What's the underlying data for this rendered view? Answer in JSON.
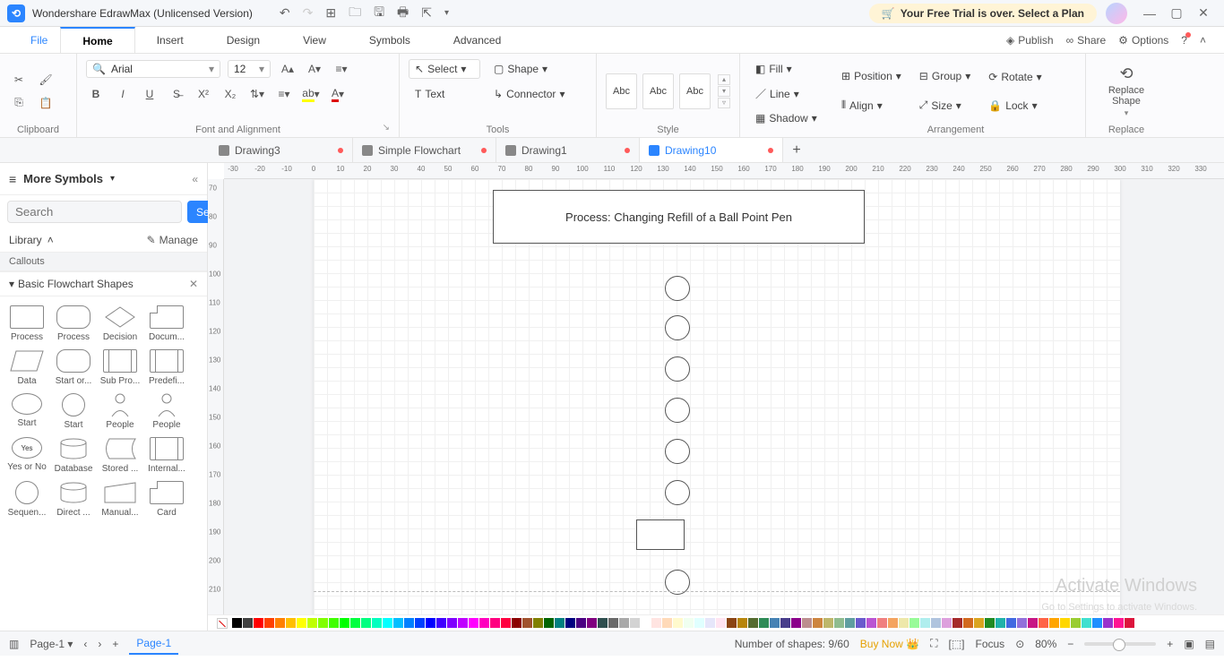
{
  "titlebar": {
    "app_title": "Wondershare EdrawMax (Unlicensed Version)",
    "trial_text": "Your Free Trial is over. Select a Plan"
  },
  "menubar": {
    "file": "File",
    "tabs": [
      "Home",
      "Insert",
      "Design",
      "View",
      "Symbols",
      "Advanced"
    ],
    "right": {
      "publish": "Publish",
      "share": "Share",
      "options": "Options"
    }
  },
  "ribbon": {
    "clipboard_label": "Clipboard",
    "font_label": "Font and Alignment",
    "tools_label": "Tools",
    "style_label": "Style",
    "arrangement_label": "Arrangement",
    "replace_label": "Replace",
    "font_name": "Arial",
    "font_size": "12",
    "select": "Select",
    "shape": "Shape",
    "text": "Text",
    "connector": "Connector",
    "style_sample": "Abc",
    "fill": "Fill",
    "line": "Line",
    "shadow": "Shadow",
    "position": "Position",
    "align": "Align",
    "group": "Group",
    "size": "Size",
    "rotate": "Rotate",
    "lock": "Lock",
    "replace_shape": "Replace\nShape"
  },
  "doctabs": {
    "tabs": [
      {
        "label": "Drawing3",
        "dirty": true
      },
      {
        "label": "Simple Flowchart",
        "dirty": true
      },
      {
        "label": "Drawing1",
        "dirty": true
      },
      {
        "label": "Drawing10",
        "dirty": true,
        "active": true
      }
    ]
  },
  "sidebar": {
    "title": "More Symbols",
    "search_placeholder": "Search",
    "search_btn": "Search",
    "library": "Library",
    "manage": "Manage",
    "callouts": "Callouts",
    "category": "Basic Flowchart Shapes",
    "shapes": [
      [
        "Process",
        "Process",
        "Decision",
        "Docum..."
      ],
      [
        "Data",
        "Start or...",
        "Sub Pro...",
        "Predefi..."
      ],
      [
        "Start",
        "Start",
        "People",
        "People"
      ],
      [
        "Yes or No",
        "Database",
        "Stored ...",
        "Internal..."
      ],
      [
        "Sequen...",
        "Direct ...",
        "Manual...",
        "Card"
      ]
    ]
  },
  "canvas": {
    "title_box": "Process: Changing Refill of a Ball Point Pen",
    "hruler": [
      -30,
      -20,
      -10,
      0,
      10,
      20,
      30,
      40,
      50,
      60,
      70,
      80,
      90,
      100,
      110,
      120,
      130,
      140,
      150,
      160,
      170,
      180,
      190,
      200,
      210,
      220,
      230,
      240,
      250,
      260,
      270,
      280,
      290,
      300,
      310,
      320,
      330
    ],
    "vruler": [
      70,
      80,
      90,
      100,
      110,
      120,
      130,
      140,
      150,
      160,
      170,
      180,
      190,
      200,
      210
    ],
    "watermark": "Activate Windows",
    "watermark2": "Go to Settings to activate Windows."
  },
  "status": {
    "page_combo": "Page-1",
    "page_tab": "Page-1",
    "shapes": "Number of shapes: 9/60",
    "buy": "Buy Now",
    "focus": "Focus",
    "zoom": "80%"
  },
  "palette": [
    "#000000",
    "#404040",
    "#ff0000",
    "#ff4000",
    "#ff8000",
    "#ffbf00",
    "#ffff00",
    "#bfff00",
    "#80ff00",
    "#40ff00",
    "#00ff00",
    "#00ff40",
    "#00ff80",
    "#00ffbf",
    "#00ffff",
    "#00bfff",
    "#0080ff",
    "#0040ff",
    "#0000ff",
    "#4000ff",
    "#8000ff",
    "#bf00ff",
    "#ff00ff",
    "#ff00bf",
    "#ff0080",
    "#ff0040",
    "#8b0000",
    "#a0522d",
    "#808000",
    "#006400",
    "#008080",
    "#000080",
    "#4b0082",
    "#800080",
    "#2f4f4f",
    "#696969",
    "#a9a9a9",
    "#d3d3d3",
    "#ffffff",
    "#ffe4e1",
    "#ffdab9",
    "#fffacd",
    "#f0fff0",
    "#e0ffff",
    "#e6e6fa",
    "#ffe4f1",
    "#8b4513",
    "#b8860b",
    "#556b2f",
    "#2e8b57",
    "#4682b4",
    "#483d8b",
    "#8b008b",
    "#bc8f8f",
    "#cd853f",
    "#bdb76b",
    "#8fbc8f",
    "#5f9ea0",
    "#6a5acd",
    "#ba55d3",
    "#f08080",
    "#f4a460",
    "#eee8aa",
    "#98fb98",
    "#afeeee",
    "#b0c4de",
    "#dda0dd",
    "#a52a2a",
    "#d2691e",
    "#daa520",
    "#228b22",
    "#20b2aa",
    "#4169e1",
    "#9370db",
    "#c71585",
    "#ff6347",
    "#ffa500",
    "#ffd700",
    "#9acd32",
    "#40e0d0",
    "#1e90ff",
    "#9932cc",
    "#ff1493",
    "#dc143c"
  ]
}
